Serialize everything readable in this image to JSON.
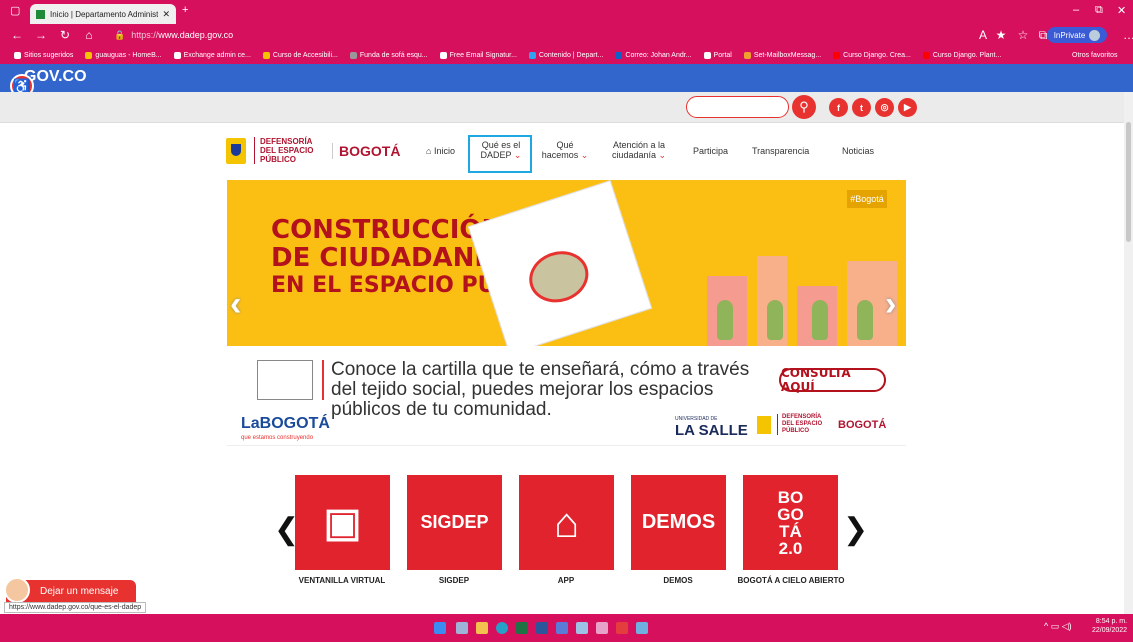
{
  "browser": {
    "tab_title": "Inicio | Departamento Administr...",
    "url_scheme": "https://",
    "url_host": "www.dadep.gov.co",
    "inprivate_label": "InPrivate",
    "favorites": [
      {
        "label": "Sitios sugeridos",
        "color": "#ffffff"
      },
      {
        "label": "guauguas - HomeB...",
        "color": "#f5c400"
      },
      {
        "label": "Exchange admin ce...",
        "color": "#ffffff"
      },
      {
        "label": "Curso de Accesibili...",
        "color": "#f5c400"
      },
      {
        "label": "Funda de sofá esqu...",
        "color": "#999999"
      },
      {
        "label": "Free Email Signatur...",
        "color": "#ffffff"
      },
      {
        "label": "Contenido | Depart...",
        "color": "#2ea3f2"
      },
      {
        "label": "Correo: Johan Andr...",
        "color": "#0a64c8"
      },
      {
        "label": "Portal",
        "color": "#ffffff"
      },
      {
        "label": "Set-MailboxMessag...",
        "color": "#f0a030"
      },
      {
        "label": "Curso Django. Crea...",
        "color": "#ff0000"
      },
      {
        "label": "Curso Django. Plant...",
        "color": "#ff0000"
      }
    ],
    "other_favorites": "Otros favoritos"
  },
  "gov": {
    "logo": "GOV.CO"
  },
  "social": [
    "f",
    "t",
    "◎",
    "▶"
  ],
  "nav": {
    "inicio": "Inicio",
    "que_es": "Qué es el DADEP",
    "que_hacemos": "Qué hacemos",
    "atencion": "Atención a la ciudadanía",
    "participa": "Participa",
    "transparencia": "Transparencia",
    "noticias": "Noticias",
    "logo_dadep": "DEFENSORÍA DEL ESPACIO PÚBLICO",
    "logo_bogota": "BOGOTÁ"
  },
  "banner": {
    "line1": "CONSTRUCCIÓN",
    "line2": "DE CIUDADANÍA",
    "line3": "EN EL ESPACIO PÚBLICO",
    "hashtag": "#Bogotá",
    "desc": "Conoce la cartilla que te enseñará, cómo a través del tejido social, puedes mejorar los espacios públicos de tu comunidad.",
    "cta": "CONSULTA AQUÍ",
    "labogota": "LaBOGOTÁ",
    "labogota_sub": "que estamos construyendo",
    "lasalle": "LA SALLE",
    "lasalle_sub": "UNIVERSIDAD DE",
    "logo_dadep": "DEFENSORÍA DEL ESPACIO PÚBLICO",
    "logo_bogota": "BOGOTÁ"
  },
  "tiles": [
    {
      "label": "VENTANILLA VIRTUAL",
      "text": "▣"
    },
    {
      "label": "SIGDEP",
      "text": "SIGDEP"
    },
    {
      "label": "APP",
      "text": "⌂"
    },
    {
      "label": "DEMOS",
      "text": "DEMOS"
    },
    {
      "label": "BOGOTÁ A CIELO ABIERTO",
      "text": "BO GO TÁ 2.0"
    }
  ],
  "chat": {
    "label": "Dejar un mensaje"
  },
  "status_url": "https://www.dadep.gov.co/que-es-el-dadep",
  "clock": {
    "time": "8:54 p. m.",
    "date": "22/09/2022"
  }
}
